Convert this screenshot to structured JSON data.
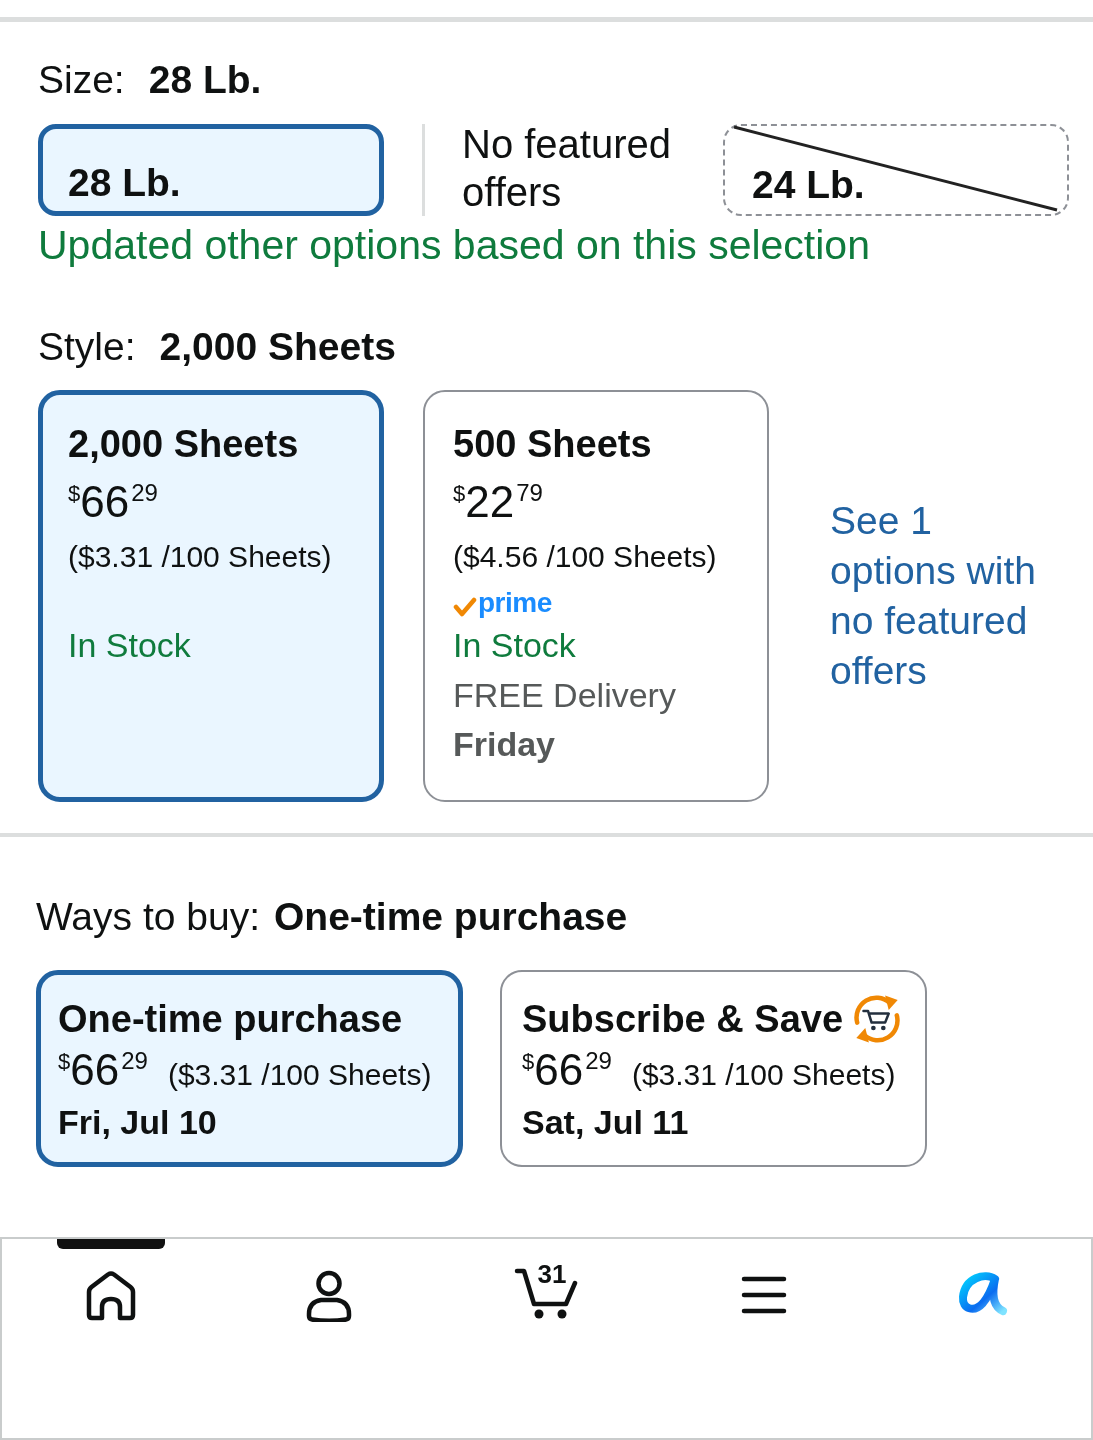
{
  "size": {
    "label": "Size:",
    "value": "28 Lb.",
    "options": [
      {
        "label": "28 Lb.",
        "selected": true
      }
    ],
    "unavailable_heading": "No featured offers",
    "unavailable_options": [
      {
        "label": "24 Lb.",
        "selected": false
      }
    ],
    "notice": "Updated other options based on this selection"
  },
  "style": {
    "label": "Style:",
    "value": "2,000 Sheets",
    "options": [
      {
        "title": "2,000 Sheets",
        "selected": true,
        "price_symbol": "$",
        "price_whole": "66",
        "price_fraction": "29",
        "unit_price": "($3.31 /100 Sheets)",
        "availability": "In Stock"
      },
      {
        "title": "500 Sheets",
        "selected": false,
        "price_symbol": "$",
        "price_whole": "22",
        "price_fraction": "79",
        "unit_price": "($4.56 /100 Sheets)",
        "badge": "prime",
        "availability": "In Stock",
        "delivery": "FREE Delivery",
        "delivery_day": "Friday"
      }
    ],
    "more_link": "See 1 options with no featured offers"
  },
  "ways_to_buy": {
    "label": "Ways to buy:",
    "value": "One-time purchase",
    "options": [
      {
        "kind": "one_time",
        "title": "One-time purchase",
        "selected": true,
        "price_symbol": "$",
        "price_whole": "66",
        "price_fraction": "29",
        "unit_price": "($3.31 /100 Sheets)",
        "date": "Fri, Jul 10"
      },
      {
        "kind": "subscribe",
        "title": "Subscribe & Save",
        "selected": false,
        "price_symbol": "$",
        "price_whole": "66",
        "price_fraction": "29",
        "unit_price": "($3.31 /100 Sheets)",
        "date": "Sat, Jul 11"
      }
    ]
  },
  "bottom_nav": {
    "items": [
      {
        "kind": "home",
        "selected": true
      },
      {
        "kind": "account",
        "selected": false
      },
      {
        "kind": "cart",
        "selected": false,
        "count": "31"
      },
      {
        "kind": "menu",
        "selected": false
      },
      {
        "kind": "assistant",
        "selected": false
      }
    ]
  }
}
